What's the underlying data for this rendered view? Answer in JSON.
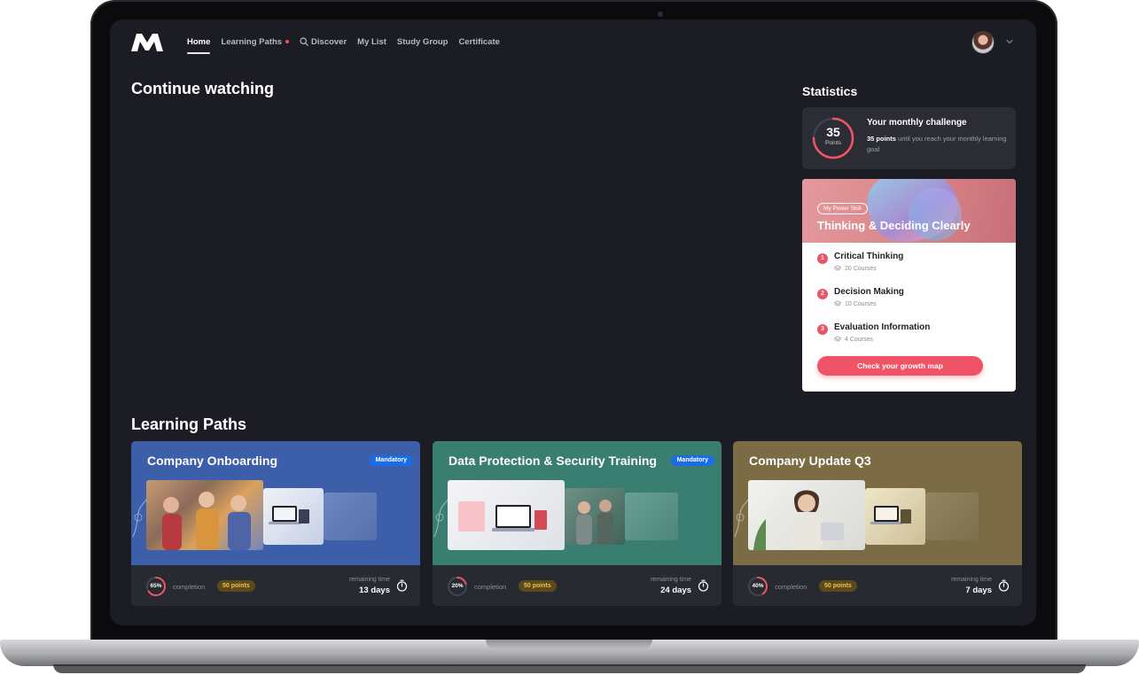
{
  "nav": {
    "items": [
      {
        "label": "Home"
      },
      {
        "label": "Learning Paths"
      },
      {
        "label": "Discover"
      },
      {
        "label": "My List"
      },
      {
        "label": "Study Group"
      },
      {
        "label": "Certificate"
      }
    ]
  },
  "sections": {
    "continue": "Continue watching",
    "statistics": "Statistics",
    "learning_paths": "Learning Paths"
  },
  "challenge": {
    "points": "35",
    "points_label": "Points",
    "progress": 0.75,
    "title": "Your monthly challenge",
    "desc_bold": "35 points",
    "desc_rest": " until you reach your monthly learning goal"
  },
  "power_skill": {
    "badge": "My Power Skill",
    "title": "Thinking & Deciding Clearly",
    "items": [
      {
        "num": "1",
        "title": "Critical Thinking",
        "sub": "20 Courses"
      },
      {
        "num": "2",
        "title": "Decision Making",
        "sub": "10 Courses"
      },
      {
        "num": "3",
        "title": "Evaluation Information",
        "sub": "4 Courses"
      }
    ],
    "button": "Check your growth map"
  },
  "paths": [
    {
      "title": "Company Onboarding",
      "badge": "Mandatory",
      "pct": "65%",
      "progress": 0.65,
      "completion": "completion",
      "points": "50 points",
      "remaining_label": "remaining time",
      "remaining": "13 days",
      "color": "#3d5ea8"
    },
    {
      "title": "Data Protection & Security Training",
      "badge": "Mandatory",
      "pct": "20%",
      "progress": 0.2,
      "completion": "completion",
      "points": "50 points",
      "remaining_label": "remaining time",
      "remaining": "24 days",
      "color": "#3a7e72"
    },
    {
      "title": "Company Update Q3",
      "badge": "",
      "pct": "40%",
      "progress": 0.4,
      "completion": "completion",
      "points": "50 points",
      "remaining_label": "remaining time",
      "remaining": "7 days",
      "color": "#7c6c45"
    }
  ],
  "colors": {
    "accent": "#ef5366",
    "mandatory": "#1b6ce8",
    "points_text": "#f5c043",
    "background": "#1c1d24"
  }
}
